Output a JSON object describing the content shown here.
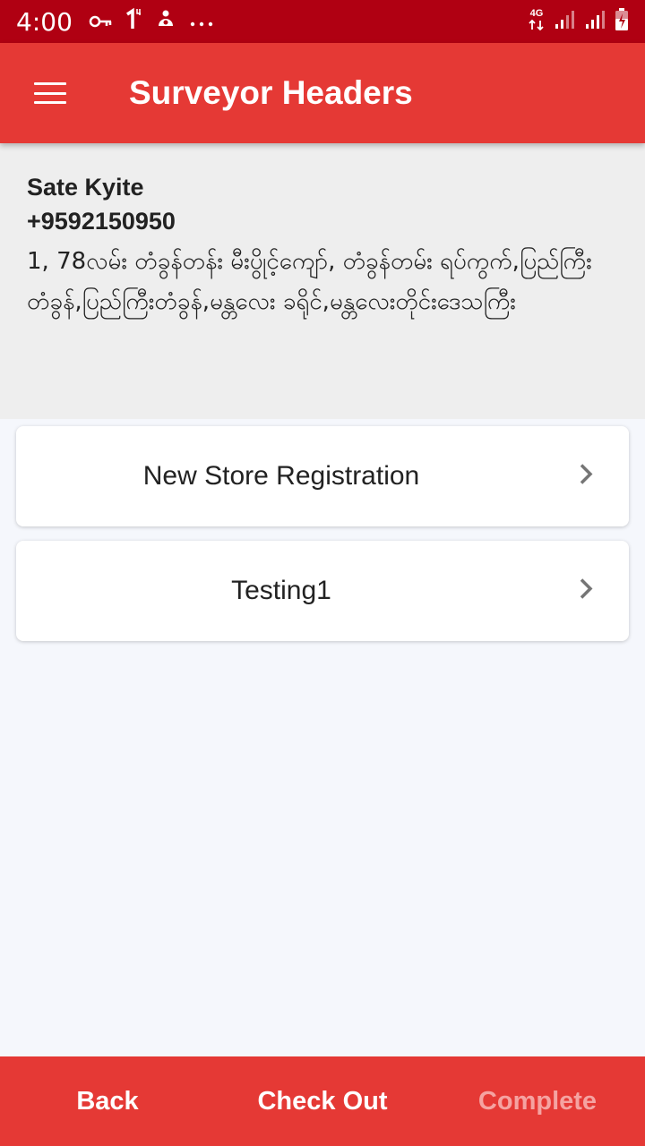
{
  "status_bar": {
    "time": "4:00",
    "icons_left": [
      "key-icon",
      "sim-1-icon",
      "app-notification-icon",
      "more-dots-icon"
    ],
    "network_label": "4G",
    "icons_right": [
      "signal-icon",
      "signal-icon",
      "battery-charging-icon"
    ]
  },
  "app_bar": {
    "menu_icon": "hamburger-menu-icon",
    "title": "Surveyor Headers"
  },
  "profile": {
    "name": "Sate Kyite",
    "phone": "+9592150950",
    "address": "1, 78လမ်း တံခွန်တန်း မီးပွိုင့်ကျော်, တံခွန်တမ်း ရပ်ကွက်,ပြည်ကြီးတံခွန်,ပြည်ကြီးတံခွန်,မန္တလေး ခရိုင်,မန္တလေးတိုင်းဒေသကြီး"
  },
  "menu_items": [
    {
      "label": "New Store Registration",
      "icon": "chevron-right-icon"
    },
    {
      "label": "Testing1",
      "icon": "chevron-right-icon"
    }
  ],
  "bottom_bar": {
    "back_label": "Back",
    "checkout_label": "Check Out",
    "complete_label": "Complete"
  },
  "colors": {
    "status_bar": "#b00012",
    "primary": "#e53935",
    "disabled_text": "#f5a3a1",
    "background": "#f5f7fc",
    "profile_bg": "#eeeeee"
  }
}
